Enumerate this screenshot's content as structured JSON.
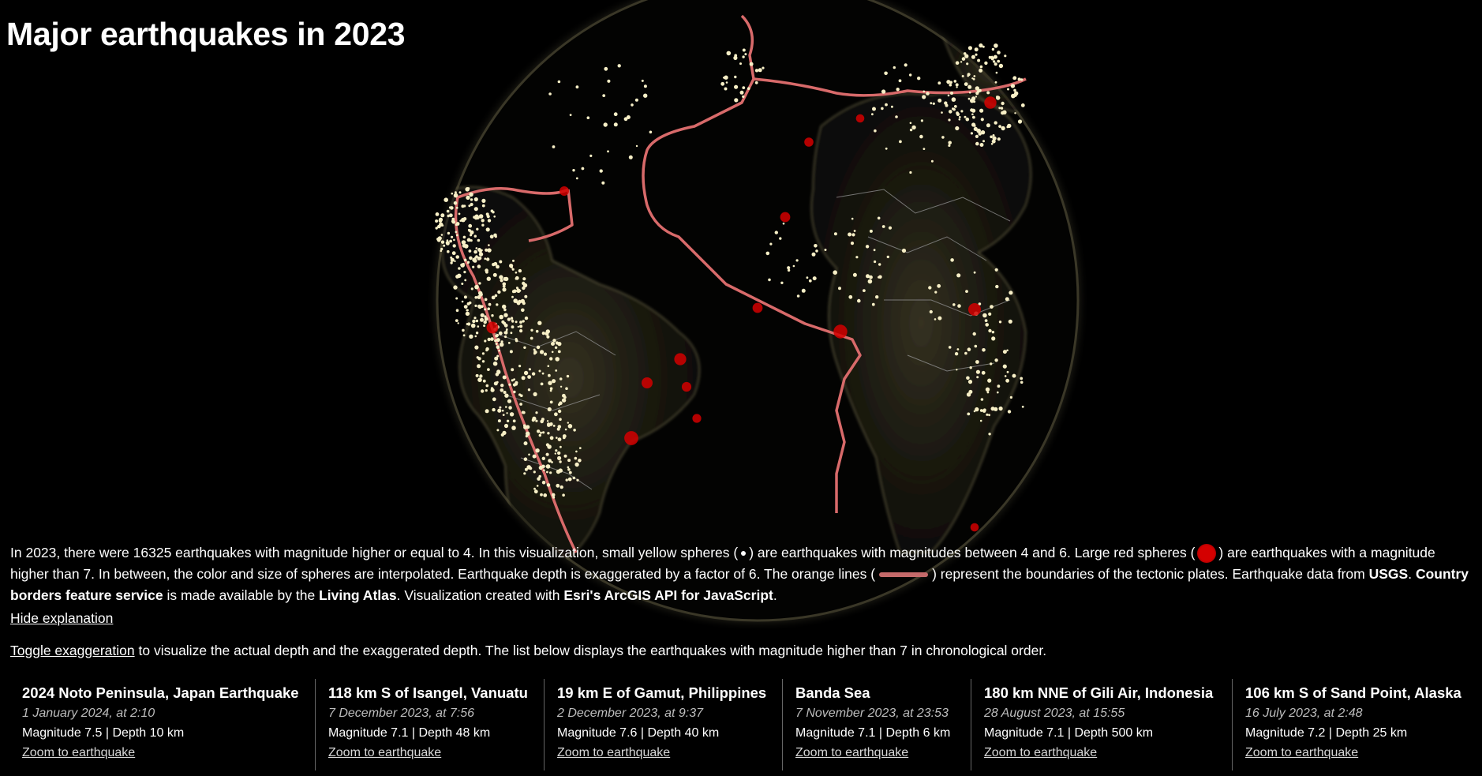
{
  "title": "Major earthquakes in 2023",
  "colors": {
    "background": "#000000",
    "plate_boundary": "#d86a6a",
    "minor_quake": "#f7efc6",
    "major_quake": "#d40000"
  },
  "explanation": {
    "p1": "In 2023, there were 16325 earthquakes with magnitude higher or equal to 4. In this visualization, small yellow spheres (",
    "p2": ") are earthquakes with magnitudes between 4 and 6. Large red spheres (",
    "p3": ") are earthquakes with a magnitude higher than 7. In between, the color and size of spheres are interpolated. Earthquake depth is exaggerated by a factor of 6. The orange lines (",
    "p4": ") represent the boundaries of the tectonic plates. Earthquake data from ",
    "usgs": "USGS",
    "p5": ". ",
    "borders": "Country borders feature service",
    "p6": " is made available by the ",
    "atlas": "Living Atlas",
    "p7": ". Visualization created with ",
    "esri": "Esri's ArcGIS API for JavaScript",
    "p8": ".",
    "hide_link": "Hide explanation"
  },
  "intro": {
    "toggle_link": "Toggle exaggeration",
    "text": " to visualize the actual depth and the exaggerated depth. The list below displays the earthquakes with magnitude higher than 7 in chronological order."
  },
  "quakes": [
    {
      "title": "2024 Noto Peninsula, Japan Earthquake",
      "date": "1 January 2024, at 2:10",
      "details": "Magnitude 7.5 | Depth 10 km",
      "zoom": "Zoom to earthquake"
    },
    {
      "title": "118 km S of Isangel, Vanuatu",
      "date": "7 December 2023, at 7:56",
      "details": "Magnitude 7.1 | Depth 48 km",
      "zoom": "Zoom to earthquake"
    },
    {
      "title": "19 km E of Gamut, Philippines",
      "date": "2 December 2023, at 9:37",
      "details": "Magnitude 7.6 | Depth 40 km",
      "zoom": "Zoom to earthquake"
    },
    {
      "title": "Banda Sea",
      "date": "7 November 2023, at 23:53",
      "details": "Magnitude 7.1 | Depth 6 km",
      "zoom": "Zoom to earthquake"
    },
    {
      "title": "180 km NNE of Gili Air, Indonesia",
      "date": "28 August 2023, at 15:55",
      "details": "Magnitude 7.1 | Depth 500 km",
      "zoom": "Zoom to earthquake"
    },
    {
      "title": "106 km S of Sand Point, Alaska",
      "date": "16 July 2023, at 2:48",
      "details": "Magnitude 7.2 | Depth 25 km",
      "zoom": "Zoom to earthquake"
    }
  ]
}
